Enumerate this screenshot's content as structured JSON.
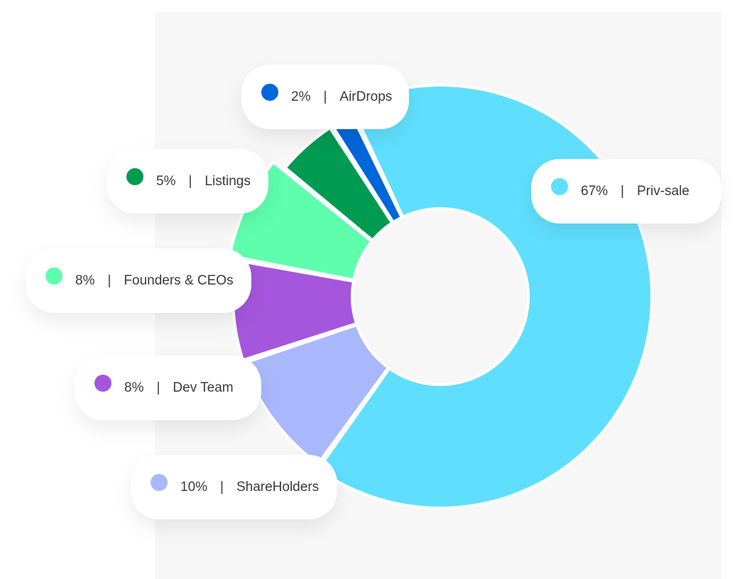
{
  "chart_data": {
    "type": "pie",
    "donut": true,
    "title": "",
    "slices": [
      {
        "label": "Priv-sale",
        "value": 67,
        "pct_label": "67%",
        "color": "#5fdffd"
      },
      {
        "label": "ShareHolders",
        "value": 10,
        "pct_label": "10%",
        "color": "#a9b8fd"
      },
      {
        "label": "Dev Team",
        "value": 8,
        "pct_label": "8%",
        "color": "#a556dc"
      },
      {
        "label": "Founders & CEOs",
        "value": 8,
        "pct_label": "8%",
        "color": "#5efead"
      },
      {
        "label": "Listings",
        "value": 5,
        "pct_label": "5%",
        "color": "#009a51"
      },
      {
        "label": "AirDrops",
        "value": 2,
        "pct_label": "2%",
        "color": "#0067d9"
      }
    ]
  },
  "labels": {
    "privsale": {
      "pct": "67%",
      "name": "Priv-sale",
      "separator": "|"
    },
    "airdrops": {
      "pct": "2%",
      "name": "AirDrops",
      "separator": "|"
    },
    "listings": {
      "pct": "5%",
      "name": "Listings",
      "separator": "|"
    },
    "founders": {
      "pct": "8%",
      "name": "Founders & CEOs",
      "separator": "|"
    },
    "devteam": {
      "pct": "8%",
      "name": "Dev Team",
      "separator": "|"
    },
    "shareholders": {
      "pct": "10%",
      "name": "ShareHolders",
      "separator": "|"
    }
  }
}
